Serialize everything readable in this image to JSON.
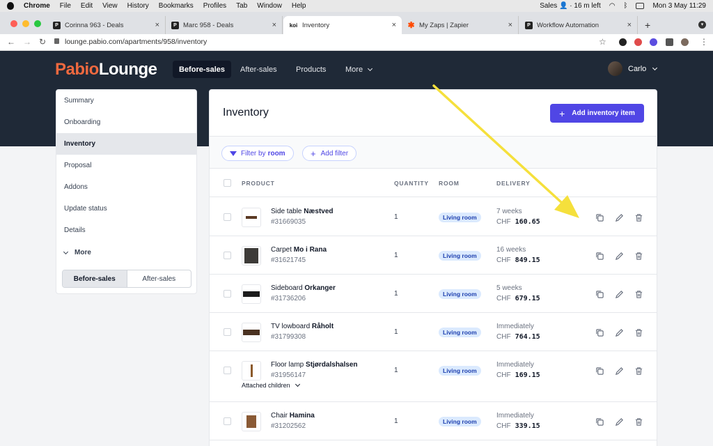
{
  "menubar": {
    "app": "Chrome",
    "items": [
      "File",
      "Edit",
      "View",
      "History",
      "Bookmarks",
      "Profiles",
      "Tab",
      "Window",
      "Help"
    ],
    "status": "Sales 👤 · 16 m left",
    "clock": "Mon 3 May  11:29"
  },
  "tabs": [
    {
      "label": "Corinna 963 - Deals",
      "icon": "P"
    },
    {
      "label": "Marc 958 - Deals",
      "icon": "P"
    },
    {
      "label": "Inventory",
      "icon": "koi"
    },
    {
      "label": "My Zaps | Zapier",
      "icon": "✱"
    },
    {
      "label": "Workflow Automation",
      "icon": "P"
    }
  ],
  "address": {
    "url": "lounge.pabio.com/apartments/958/inventory"
  },
  "brand": {
    "part1": "Pabio",
    "part2": "Lounge",
    "accent": "#f0693f"
  },
  "topnav": {
    "items": [
      "Before-sales",
      "After-sales",
      "Products",
      "More"
    ],
    "user": "Carlo"
  },
  "sidebar": {
    "items": [
      "Summary",
      "Onboarding",
      "Inventory",
      "Proposal",
      "Addons",
      "Update status",
      "Details"
    ],
    "more": "More",
    "segment": [
      "Before-sales",
      "After-sales"
    ]
  },
  "panel": {
    "title": "Inventory",
    "add_button": "Add inventory item",
    "filter_label": "Filter by",
    "filter_value": "room",
    "add_filter": "Add filter",
    "columns": [
      "PRODUCT",
      "QUANTITY",
      "ROOM",
      "DELIVERY"
    ]
  },
  "rows": [
    {
      "name": "Side table",
      "name_bold": "Næstved",
      "sku": "#31669035",
      "qty": "1",
      "room": "Living room",
      "delivery": "7 weeks",
      "currency": "CHF",
      "price": "160.65"
    },
    {
      "name": "Carpet",
      "name_bold": "Mo i Rana",
      "sku": "#31621745",
      "qty": "1",
      "room": "Living room",
      "delivery": "16 weeks",
      "currency": "CHF",
      "price": "849.15"
    },
    {
      "name": "Sideboard",
      "name_bold": "Orkanger",
      "sku": "#31736206",
      "qty": "1",
      "room": "Living room",
      "delivery": "5 weeks",
      "currency": "CHF",
      "price": "679.15"
    },
    {
      "name": "TV lowboard",
      "name_bold": "Råholt",
      "sku": "#31799308",
      "qty": "1",
      "room": "Living room",
      "delivery": "Immediately",
      "currency": "CHF",
      "price": "764.15"
    },
    {
      "name": "Floor lamp",
      "name_bold": "Stjørdalshalsen",
      "sku": "#31956147",
      "qty": "1",
      "room": "Living room",
      "delivery": "Immediately",
      "currency": "CHF",
      "price": "169.15",
      "attached": "Attached children"
    },
    {
      "name": "Chair",
      "name_bold": "Hamina",
      "sku": "#31202562",
      "qty": "1",
      "room": "Living room",
      "delivery": "Immediately",
      "currency": "CHF",
      "price": "339.15"
    }
  ],
  "colors": {
    "primary": "#5046e5",
    "header_bg": "#1f2937",
    "annotation_arrow": "#f5e03c"
  }
}
